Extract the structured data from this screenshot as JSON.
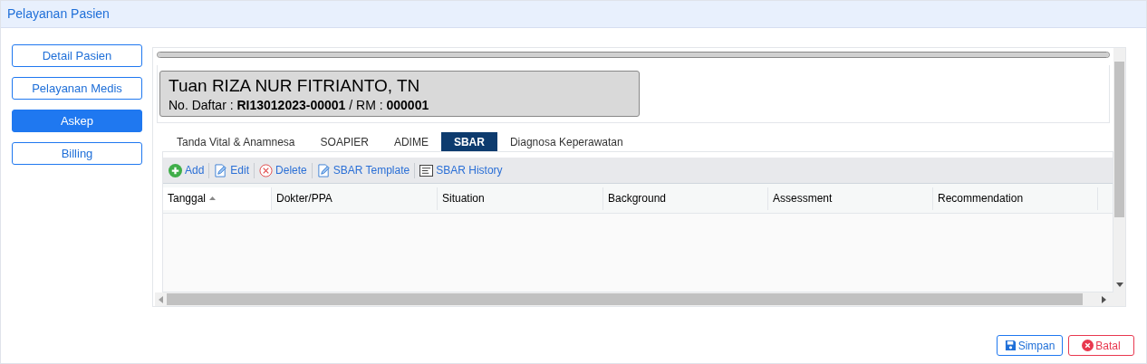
{
  "header": {
    "title": "Pelayanan Pasien"
  },
  "sidebar": {
    "items": [
      {
        "label": "Detail Pasien",
        "selected": false
      },
      {
        "label": "Pelayanan Medis",
        "selected": false
      },
      {
        "label": "Askep",
        "selected": true
      },
      {
        "label": "Billing",
        "selected": false
      }
    ]
  },
  "progress": {
    "level": 1
  },
  "patient": {
    "name": "Tuan RIZA NUR FITRIANTO, TN",
    "registration": "No. Daftar : **RI13012023-00001** / RM : **000001**"
  },
  "tabs": [
    {
      "label": "Tanda Vital & Anamnesa",
      "selected": false
    },
    {
      "label": "SOAPIER",
      "selected": false
    },
    {
      "label": "ADIME",
      "selected": false
    },
    {
      "label": "SBAR",
      "selected": true
    },
    {
      "label": "Diagnosa Keperawatan",
      "selected": false
    }
  ],
  "toolbar": [
    {
      "kind": "add",
      "label": "Add"
    },
    {
      "kind": "edit",
      "label": "Edit"
    },
    {
      "kind": "delete",
      "label": "Delete"
    },
    {
      "kind": "template",
      "label": "SBAR Template"
    },
    {
      "kind": "history",
      "label": "SBAR History"
    }
  ],
  "table": {
    "columns": [
      {
        "label": "Tanggal",
        "sorted": true
      },
      {
        "label": "Dokter/PPA",
        "sorted": false
      },
      {
        "label": "Situation",
        "sorted": false
      },
      {
        "label": "Background",
        "sorted": false
      },
      {
        "label": "Assessment",
        "sorted": false
      },
      {
        "label": "Recommendation",
        "sorted": false
      }
    ]
  },
  "buttons": [
    {
      "kind": "save",
      "label": "Simpan"
    },
    {
      "kind": "cancel",
      "label": "Batal"
    }
  ]
}
